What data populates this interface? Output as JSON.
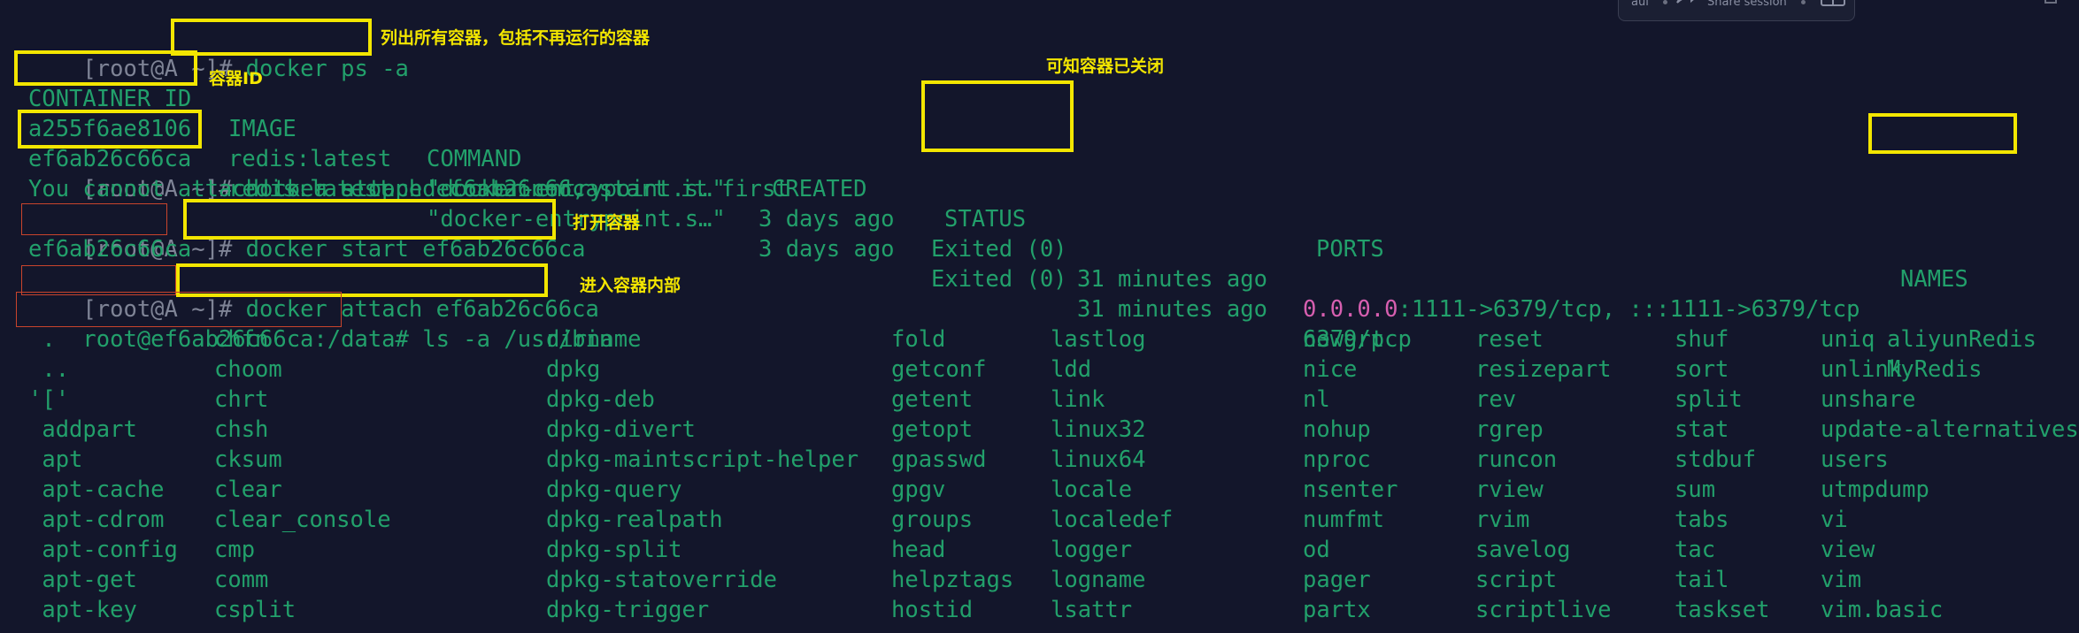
{
  "toolbar": {
    "partial_label": "aul",
    "share_label": "Share session"
  },
  "terminal": {
    "prompt": "[root@A ~]#",
    "cmd1": "docker ps -a",
    "ps_headers": {
      "container_id": "CONTAINER ID",
      "image": "IMAGE",
      "command": "COMMAND",
      "created": "CREATED",
      "status": "STATUS",
      "ports": "PORTS",
      "names": "NAMES"
    },
    "ps_rows": [
      {
        "id": "a255f6ae8106",
        "image": "redis:latest",
        "command": "\"docker-entrypoint.s…\"",
        "created": "3 days ago",
        "status": "Exited (0)",
        "status_ago": "31 minutes ago",
        "ports_ip": "0.0.0.0",
        "ports_rest": ":1111->6379/tcp, :::1111->6379/tcp",
        "name": "aliyunRedis"
      },
      {
        "id": "ef6ab26c66ca",
        "image": "redis:latest",
        "command": "\"docker-entrypoint.s…\"",
        "created": "3 days ago",
        "status": "Exited (0)",
        "status_ago": "31 minutes ago",
        "ports_ip": "",
        "ports_rest": "6379/tcp",
        "name": "MyRedis"
      }
    ],
    "cmd2": "docker attach ef6ab26c66ca",
    "error_line": "You cannot attach to a stopped container, start it first",
    "cmd3": "docker start ef6ab26c66ca",
    "start_output": "ef6ab26c66ca",
    "cmd4": "docker attach ef6ab26c66ca",
    "container_prompt": "root@ef6ab26c66ca:/data#",
    "cmd5": "ls -a /usr/bin",
    "ls_rows": [
      [
        " .",
        "chfn",
        "dirname",
        "fold",
        "lastlog",
        "newgrp",
        "reset",
        "shuf",
        "uniq"
      ],
      [
        " ..",
        "choom",
        "dpkg",
        "getconf",
        "ldd",
        "nice",
        "resizepart",
        "sort",
        "unlink"
      ],
      [
        "'['",
        "chrt",
        "dpkg-deb",
        "getent",
        "link",
        "nl",
        "rev",
        "split",
        "unshare"
      ],
      [
        " addpart",
        "chsh",
        "dpkg-divert",
        "getopt",
        "linux32",
        "nohup",
        "rgrep",
        "stat",
        "update-alternatives"
      ],
      [
        " apt",
        "cksum",
        "dpkg-maintscript-helper",
        "gpasswd",
        "linux64",
        "nproc",
        "runcon",
        "stdbuf",
        "users"
      ],
      [
        " apt-cache",
        "clear",
        "dpkg-query",
        "gpgv",
        "locale",
        "nsenter",
        "rview",
        "sum",
        "utmpdump"
      ],
      [
        " apt-cdrom",
        "clear_console",
        "dpkg-realpath",
        "groups",
        "localedef",
        "numfmt",
        "rvim",
        "tabs",
        "vi"
      ],
      [
        " apt-config",
        "cmp",
        "dpkg-split",
        "head",
        "logger",
        "od",
        "savelog",
        "tac",
        "view"
      ],
      [
        " apt-get",
        "comm",
        "dpkg-statoverride",
        "helpztags",
        "logname",
        "pager",
        "script",
        "tail",
        "vim"
      ],
      [
        " apt-key",
        "csplit",
        "dpkg-trigger",
        "hostid",
        "lsattr",
        "partx",
        "scriptlive",
        "taskset",
        "vim.basic"
      ]
    ]
  },
  "annotations": {
    "list_all": "列出所有容器，包括不再运行的容器",
    "container_id": "容器ID",
    "closed": "可知容器已关闭",
    "open": "打开容器",
    "enter": "进入容器内部"
  },
  "colors": {
    "background": "#13162b",
    "text_green": "#22a06b",
    "prompt_gray": "#7f8496",
    "ip_pink": "#d75fb0",
    "highlight_yellow": "#f3e600"
  }
}
